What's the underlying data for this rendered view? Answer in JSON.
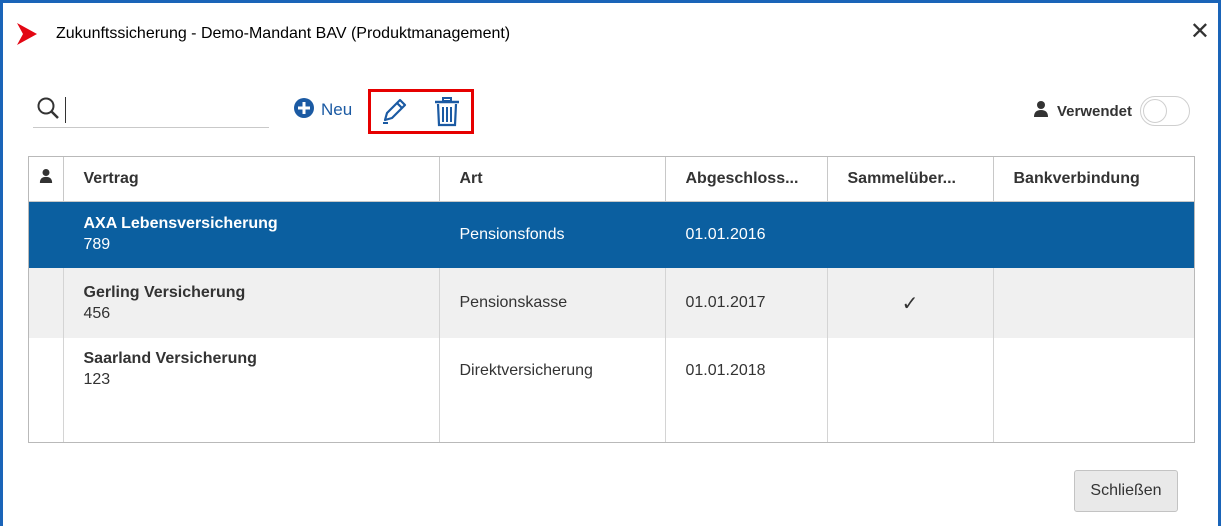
{
  "window": {
    "title": "Zukunftssicherung - Demo-Mandant BAV (Produktmanagement)",
    "close_symbol": "✕"
  },
  "toolbar": {
    "search_placeholder": "",
    "new_label": "Neu",
    "edit_icon": "pencil-icon",
    "delete_icon": "trash-icon",
    "used_label": "Verwendet",
    "used_toggle_on": false
  },
  "table": {
    "columns": [
      "",
      "Vertrag",
      "Art",
      "Abgeschloss...",
      "Sammelüber...",
      "Bankverbindung"
    ],
    "rows": [
      {
        "name": "AXA Lebensversicherung",
        "number": "789",
        "art": "Pensionsfonds",
        "date": "01.01.2016",
        "sammel": "",
        "bank": "",
        "selected": true
      },
      {
        "name": "Gerling Versicherung",
        "number": "456",
        "art": "Pensionskasse",
        "date": "01.01.2017",
        "sammel": "✓",
        "bank": "",
        "selected": false
      },
      {
        "name": "Saarland Versicherung",
        "number": "123",
        "art": "Direktversicherung",
        "date": "01.01.2018",
        "sammel": "",
        "bank": "",
        "selected": false
      }
    ]
  },
  "footer": {
    "close_button": "Schließen"
  },
  "colors": {
    "accent": "#1a64b8",
    "selected_row": "#0b5fa0",
    "highlight_frame": "#e60000",
    "logo": "#e30613"
  }
}
